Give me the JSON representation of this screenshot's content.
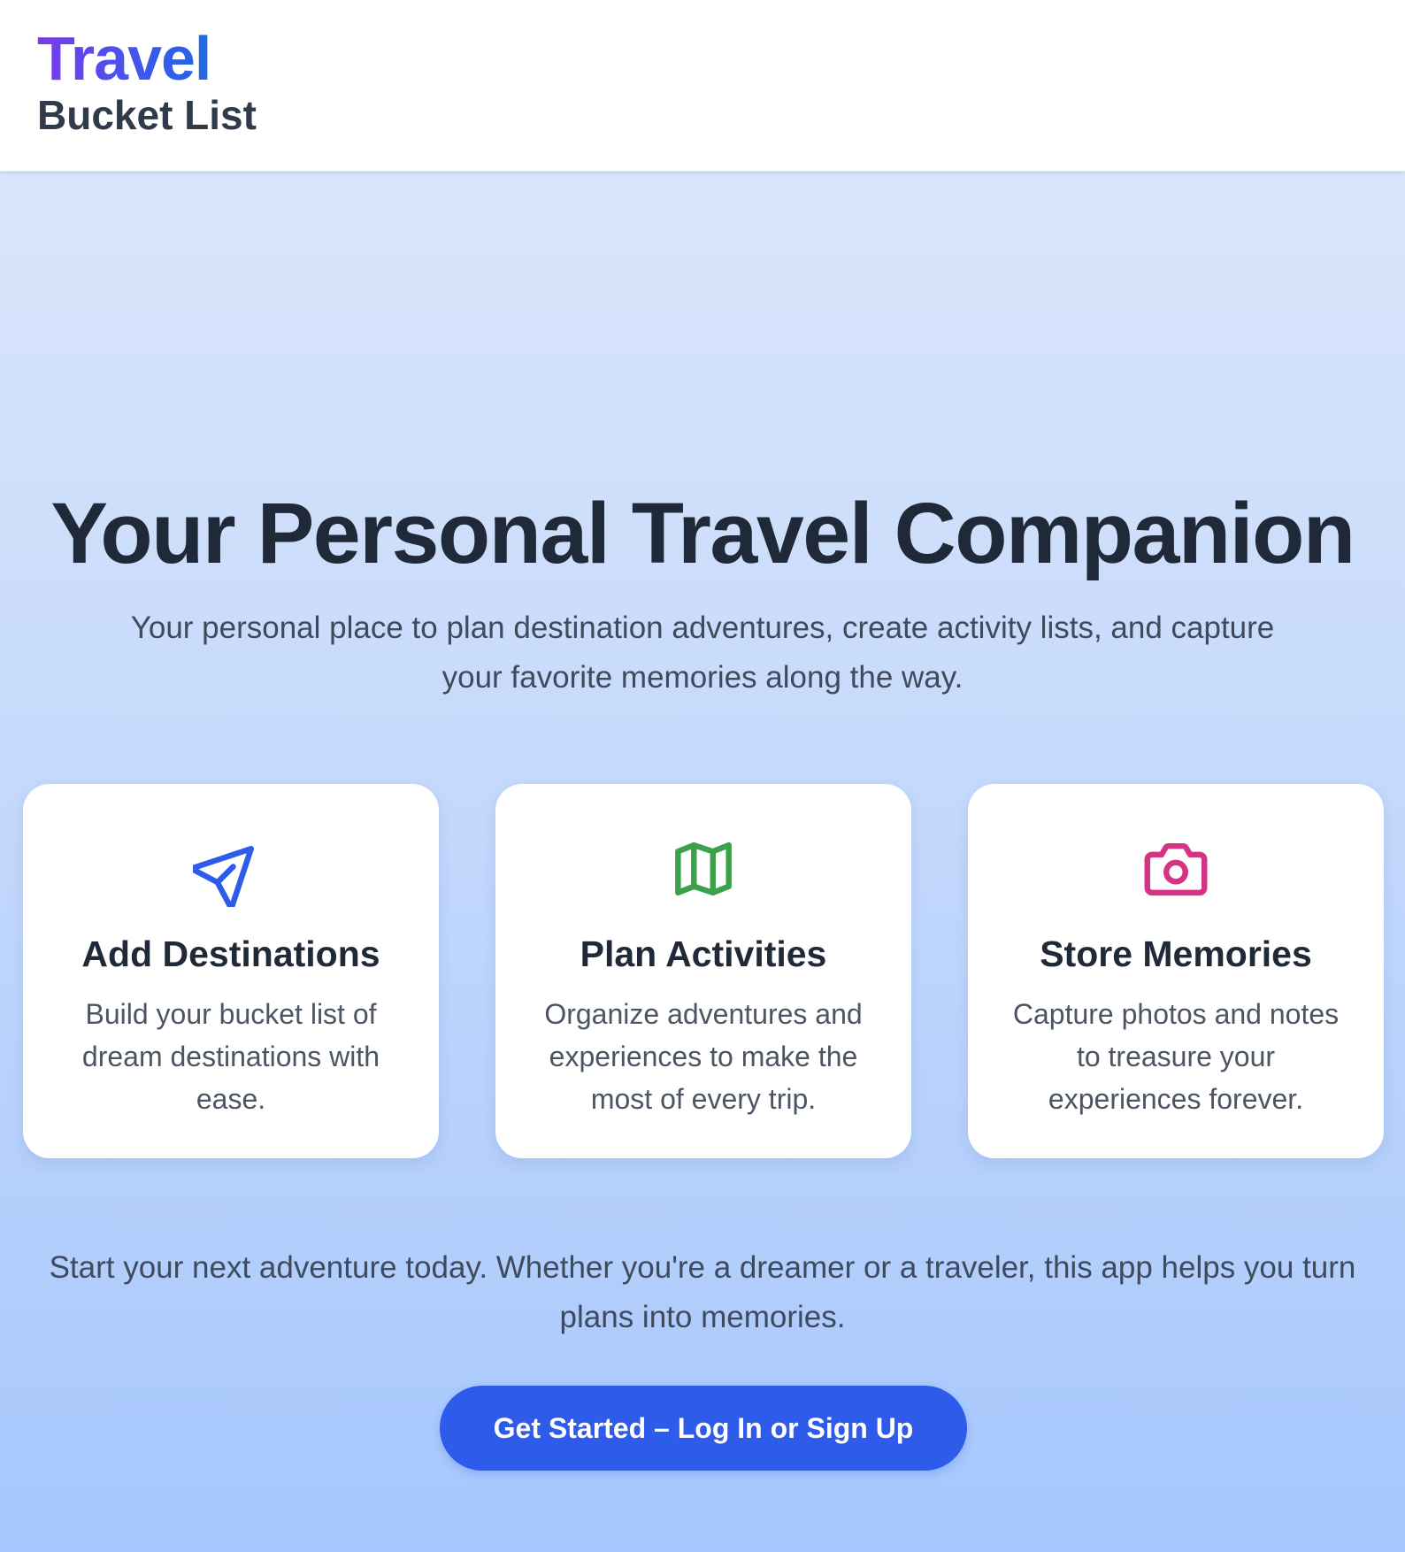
{
  "header": {
    "brand_title": "Travel",
    "brand_subtitle": "Bucket List"
  },
  "hero": {
    "title": "Your Personal Travel Companion",
    "subtitle": "Your personal place to plan destination adventures, create activity lists, and capture your favorite memories along the way."
  },
  "features": [
    {
      "icon": "airplane-icon",
      "title": "Add Destinations",
      "text": "Build your bucket list of dream destinations with ease.",
      "icon_color": "#2f5bea"
    },
    {
      "icon": "map-icon",
      "title": "Plan Activities",
      "text": "Organize adventures and experiences to make the most of every trip.",
      "icon_color": "#3da04a"
    },
    {
      "icon": "camera-icon",
      "title": "Store Memories",
      "text": "Capture photos and notes to treasure your experiences forever.",
      "icon_color": "#d63384"
    }
  ],
  "cta": {
    "text": "Start your next adventure today. Whether you're a dreamer or a traveler, this app helps you turn plans into memories.",
    "button_label": "Get Started – Log In or Sign Up"
  },
  "colors": {
    "accent": "#2f5bea",
    "brand_gradient_start": "#7c3aed",
    "brand_gradient_end": "#2563eb",
    "background_top": "#dfe9fb",
    "background_bottom": "#a6c7fd"
  }
}
